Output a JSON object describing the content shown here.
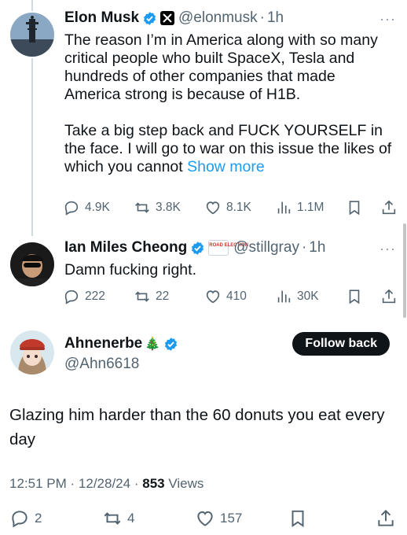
{
  "tweets": [
    {
      "name": "Elon Musk",
      "handle": "@elonmusk",
      "sep": "·",
      "time": "1h",
      "text1": "The reason I’m in America along with so many critical people who built SpaceX, Tesla and hundreds of other companies that made America strong is because of H1B.",
      "text2": "Take a big step back and FUCK YOURSELF in the face. I will go to war on this issue the likes of which you cannot",
      "show_more": "Show more",
      "replies": "4.9K",
      "reposts": "3.8K",
      "likes": "8.1K",
      "views": "1.1M",
      "more": "···"
    },
    {
      "name": "Ian Miles Cheong",
      "handle": "@stillgray",
      "sep": "·",
      "time": "1h",
      "badge_text": "ROAD ELECTION",
      "text": "Damn fucking right.",
      "replies": "222",
      "reposts": "22",
      "likes": "410",
      "views": "30K",
      "more": "···"
    }
  ],
  "focus": {
    "name": "Ahnenerbe",
    "name_emoji": "🎄",
    "handle": "@Ahn6618",
    "follow_label": "Follow back",
    "text": "Glazing him harder than the 60 donuts you eat every day",
    "time": "12:51 PM",
    "date": "12/28/24",
    "sep": "·",
    "views_count": "853",
    "views_label": "Views",
    "replies": "2",
    "reposts": "4",
    "likes": "157"
  },
  "colors": {
    "accent": "#1d9bf0",
    "verified": "#1d9bf0",
    "muted": "#536471"
  },
  "icons": [
    "reply-icon",
    "repost-icon",
    "like-icon",
    "views-icon",
    "bookmark-icon",
    "share-icon",
    "verified-icon",
    "x-badge-icon",
    "more-icon"
  ]
}
